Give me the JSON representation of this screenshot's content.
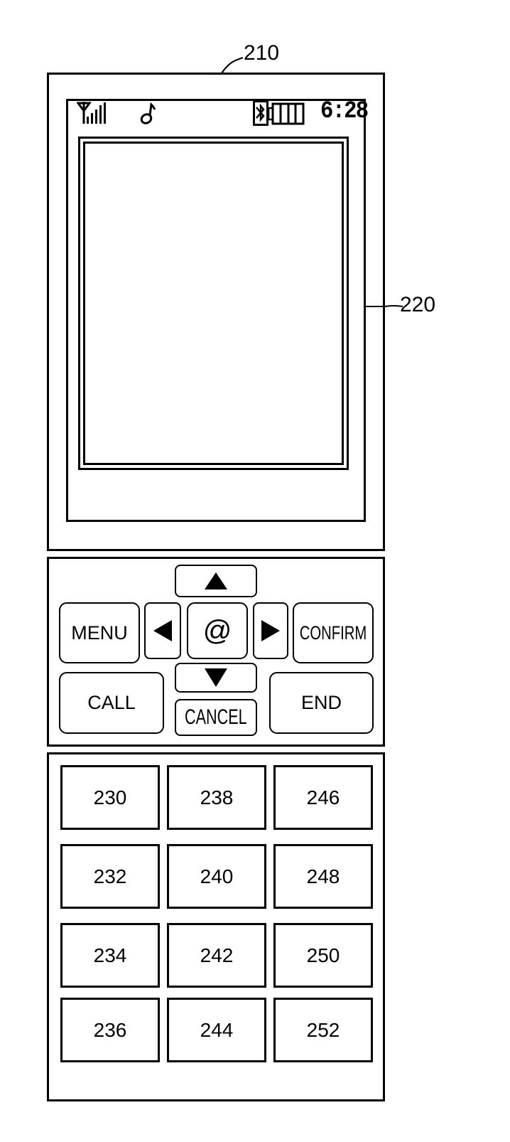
{
  "labels": {
    "device_ref": "210",
    "display_ref": "220"
  },
  "status_bar": {
    "signal_icon": "signal-antenna-icon",
    "ringtone_icon": "music-note-icon",
    "bluetooth_icon": "bluetooth-icon",
    "battery_icon": "battery-icon",
    "time": "6:28"
  },
  "nav_panel": {
    "menu": "MENU",
    "confirm": "CONFIRM",
    "center": "@",
    "call": "CALL",
    "end": "END",
    "cancel": "CANCEL",
    "up_icon": "arrow-up-icon",
    "down_icon": "arrow-down-icon",
    "left_icon": "arrow-left-icon",
    "right_icon": "arrow-right-icon"
  },
  "keypad": {
    "rows": [
      [
        "230",
        "238",
        "246"
      ],
      [
        "232",
        "240",
        "248"
      ],
      [
        "234",
        "242",
        "250"
      ],
      [
        "236",
        "244",
        "252"
      ]
    ]
  }
}
